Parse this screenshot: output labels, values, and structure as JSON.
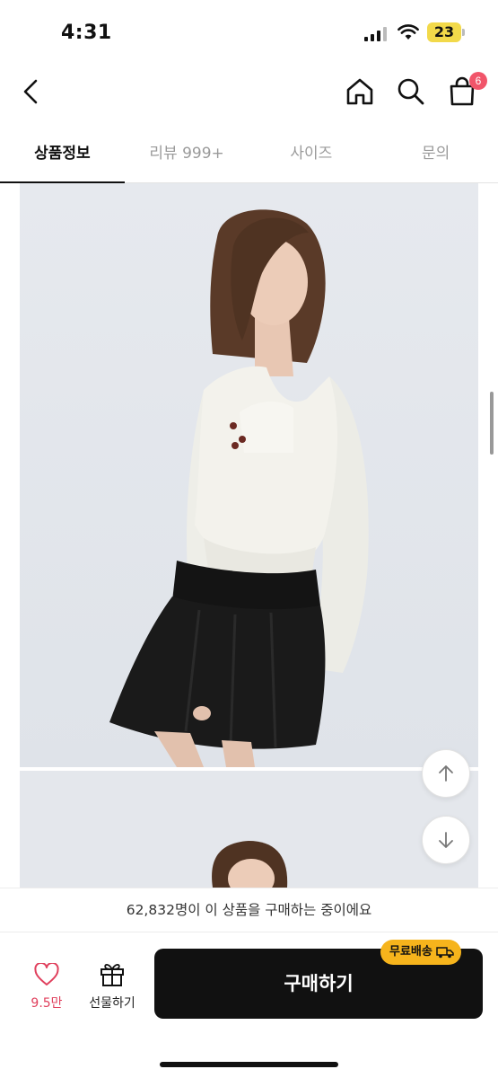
{
  "status_bar": {
    "time": "4:31",
    "battery": "23"
  },
  "nav": {
    "cart_count": "6"
  },
  "tabs": [
    {
      "label": "상품정보",
      "active": true
    },
    {
      "label": "리뷰 999+",
      "active": false
    },
    {
      "label": "사이즈",
      "active": false
    },
    {
      "label": "문의",
      "active": false
    }
  ],
  "purchase_notice": "62,832명이 이 상품을 구매하는 중이에요",
  "bottom_bar": {
    "like_count": "9.5만",
    "gift_label": "선물하기",
    "buy_label": "구매하기",
    "free_shipping_badge": "무료배송"
  },
  "colors": {
    "accent_red": "#e0405d",
    "badge_yellow": "#f6b41c",
    "cart_badge": "#f1556a",
    "buy_button": "#111111"
  },
  "icons": [
    "back-icon",
    "home-icon",
    "search-icon",
    "shopping-bag-icon",
    "heart-icon",
    "gift-icon",
    "arrow-up-icon",
    "arrow-down-icon",
    "truck-icon"
  ]
}
